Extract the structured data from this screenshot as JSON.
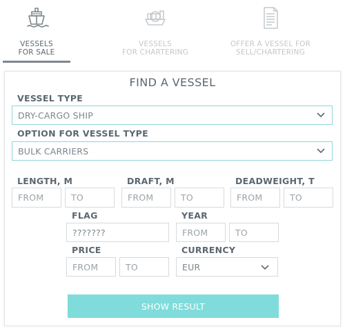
{
  "tabs": [
    {
      "line1": "VESSELS",
      "line2": "FOR SALE",
      "icon": "ship-icon",
      "active": true
    },
    {
      "line1": "VESSELS",
      "line2": "FOR CHARTERING",
      "icon": "cargo-ship-icon",
      "active": false
    },
    {
      "line1": "OFFER A VESSEL FOR",
      "line2": "SELL/CHARTERING",
      "icon": "document-icon",
      "active": false
    }
  ],
  "form": {
    "title": "FIND A VESSEL",
    "vessel_type": {
      "label": "VESSEL TYPE",
      "value": "DRY-CARGO SHIP"
    },
    "vessel_option": {
      "label": "OPTION FOR VESSEL TYPE",
      "value": "BULK CARRIERS"
    },
    "length": {
      "label": "LENGTH, M",
      "from": "FROM",
      "to": "TO"
    },
    "draft": {
      "label": "DRAFT, M",
      "from": "FROM",
      "to": "TO"
    },
    "deadweight": {
      "label": "DEADWEIGHT, T",
      "from": "FROM",
      "to": "TO"
    },
    "flag": {
      "label": "FLAG",
      "placeholder": "???????"
    },
    "year": {
      "label": "YEAR",
      "from": "FROM",
      "to": "TO"
    },
    "price": {
      "label": "PRICE",
      "from": "FROM",
      "to": "TO"
    },
    "currency": {
      "label": "CURRENCY",
      "value": "EUR"
    },
    "submit_label": "SHOW RESULT"
  },
  "colors": {
    "accent": "#7fdcdb",
    "select_border": "#8fd6dc",
    "text": "#5b6770",
    "inactive": "#c3c8cb"
  }
}
